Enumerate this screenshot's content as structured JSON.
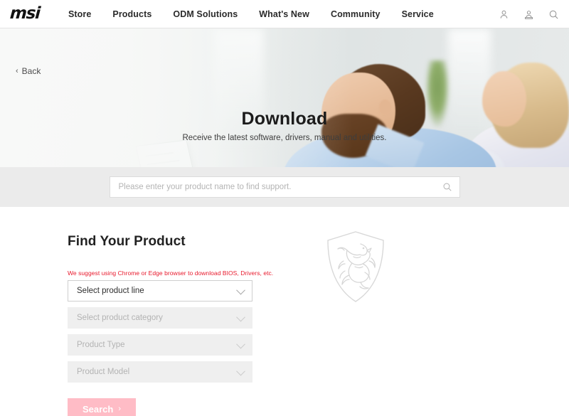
{
  "nav": {
    "logo": "msi",
    "links": [
      {
        "label": "Store"
      },
      {
        "label": "Products"
      },
      {
        "label": "ODM Solutions"
      },
      {
        "label": "What's New"
      },
      {
        "label": "Community"
      },
      {
        "label": "Service"
      }
    ],
    "icons": [
      {
        "name": "user-icon"
      },
      {
        "name": "member-icon"
      },
      {
        "name": "search-icon"
      }
    ]
  },
  "hero": {
    "back_label": "Back",
    "back_chevron": "‹",
    "title": "Download",
    "subtitle": "Receive the latest software, drivers, manual and utilities."
  },
  "search": {
    "placeholder": "Please enter your product name to find support.",
    "value": "",
    "icon": "search-icon"
  },
  "find_product": {
    "title": "Find Your Product",
    "notice": "We suggest using Chrome or Edge browser to download BIOS, Drivers, etc.",
    "notice_color": "#e8192c",
    "selects": [
      {
        "label": "Select product line",
        "state": "active"
      },
      {
        "label": "Select product category",
        "state": "disabled"
      },
      {
        "label": "Product Type",
        "state": "disabled"
      },
      {
        "label": "Product Model",
        "state": "disabled"
      }
    ],
    "search_button": {
      "label": "Search",
      "arrow": "›",
      "color": "#ffbcc6",
      "state": "disabled"
    },
    "watermark": "msi-dragon-logo"
  },
  "colors": {
    "band_gray": "#ebebeb",
    "accent_red": "#e8192c",
    "button_pink": "#ffbcc6"
  }
}
